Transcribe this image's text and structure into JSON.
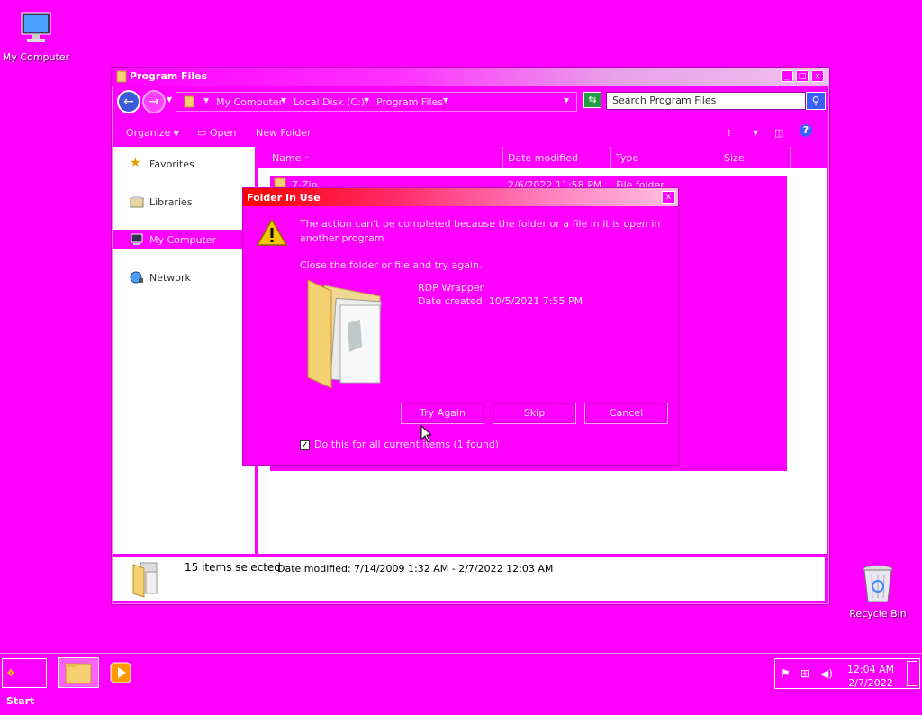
{
  "desktop": {
    "my_computer_label": "My Computer",
    "recycle_bin_label": "Recycle Bin"
  },
  "window": {
    "title": "Program Files",
    "minimize": "_",
    "maximize": "□",
    "close": "x",
    "breadcrumb": [
      "My Computer",
      "Local Disk (C:)",
      "Program Files"
    ],
    "search_placeholder": "Search Program Files",
    "toolbar": {
      "organize": "Organize",
      "open": "Open",
      "new_folder": "New Folder"
    },
    "nav": {
      "favorites": "Favorites",
      "libraries": "Libraries",
      "my_computer": "My Computer",
      "network": "Network"
    },
    "columns": [
      "Name",
      "Date modified",
      "Type",
      "Size"
    ],
    "first_row": {
      "name": "7-Zip",
      "date": "2/6/2022 11:58 PM",
      "type": "File folder"
    },
    "details": {
      "selected": "15 items selected",
      "date_modified": "Date modified: 7/14/2009 1:32 AM - 2/7/2022 12:03 AM"
    }
  },
  "dialog": {
    "title": "Folder In Use",
    "close": "x",
    "message_line1": "The action can't be completed because the folder or a file in it is open in",
    "message_line2": "another program",
    "instruction": "Close the folder or file and try again.",
    "item_name": "RDP Wrapper",
    "item_date": "Date created: 10/5/2021 7:55 PM",
    "buttons": {
      "try_again": "Try Again",
      "skip": "Skip",
      "cancel": "Cancel"
    },
    "checkbox_label": "Do this for all current items (1 found)",
    "checkbox_checked": true
  },
  "taskbar": {
    "start_label": "Start",
    "time": "12:04 AM",
    "date": "2/7/2022"
  },
  "colors": {
    "desktop": "#ff00ff",
    "dialog_title_start": "#ff0000"
  }
}
